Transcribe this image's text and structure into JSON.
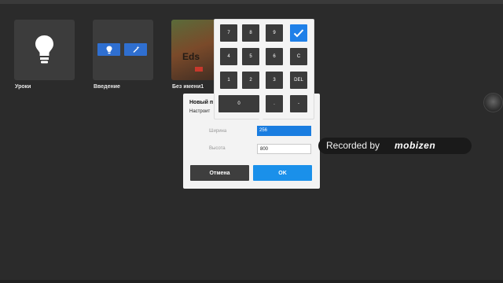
{
  "gallery": {
    "tiles": [
      {
        "label": "Уроки"
      },
      {
        "label": "Введение"
      },
      {
        "label": "Без имени1",
        "thumb_text": "Eds"
      }
    ]
  },
  "dialog": {
    "title": "Новый п",
    "subtitle": "Настроит",
    "width_label": "Ширина",
    "width_value": "256",
    "height_label": "Высота",
    "height_value": "800",
    "cancel_label": "Отмена",
    "ok_label": "OK"
  },
  "numpad": {
    "keys": [
      "7",
      "8",
      "9",
      "4",
      "5",
      "6",
      "C",
      "1",
      "2",
      "3",
      "DEL",
      "0",
      ".",
      "-"
    ]
  },
  "overlay": {
    "recorded_by": "Recorded by",
    "brand": "mobizen"
  },
  "colors": {
    "accent": "#1a90ea",
    "field_highlight": "#1a7de0",
    "background": "#2b2b2b"
  },
  "icons": {
    "lessons_tile": "lightbulb-icon",
    "intro_tile_left": "lightbulb-icon",
    "intro_tile_right": "magic-wand-icon",
    "numpad_done": "checkmark-icon"
  }
}
